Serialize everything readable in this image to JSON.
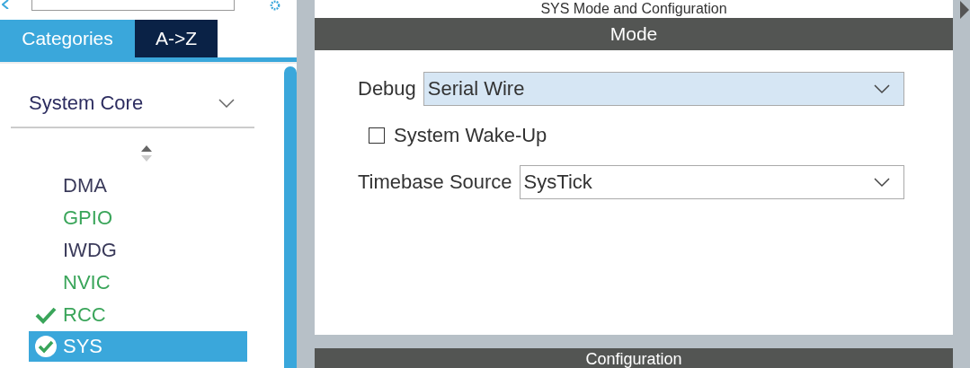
{
  "tabs": [
    {
      "label": "Categories",
      "selected": true
    },
    {
      "label": "A->Z",
      "selected": false
    }
  ],
  "category": {
    "value": "System Core"
  },
  "items": [
    {
      "label": "DMA",
      "configured": false,
      "checked": false,
      "selected": false
    },
    {
      "label": "GPIO",
      "configured": true,
      "checked": false,
      "selected": false
    },
    {
      "label": "IWDG",
      "configured": false,
      "checked": false,
      "selected": false
    },
    {
      "label": "NVIC",
      "configured": true,
      "checked": false,
      "selected": false
    },
    {
      "label": "RCC",
      "configured": true,
      "checked": true,
      "selected": false
    },
    {
      "label": "SYS",
      "configured": true,
      "checked": true,
      "selected": true
    }
  ],
  "panel": {
    "title": "SYS Mode and Configuration"
  },
  "mode": {
    "header": "Mode",
    "fields": [
      {
        "kind": "select",
        "label": "Debug",
        "value": "Serial Wire",
        "focused": true
      },
      {
        "kind": "checkbox",
        "label": "System Wake-Up",
        "checked": false
      },
      {
        "kind": "select",
        "label": "Timebase Source",
        "value": "SysTick",
        "focused": false
      }
    ]
  },
  "configuration": {
    "header": "Configuration"
  }
}
